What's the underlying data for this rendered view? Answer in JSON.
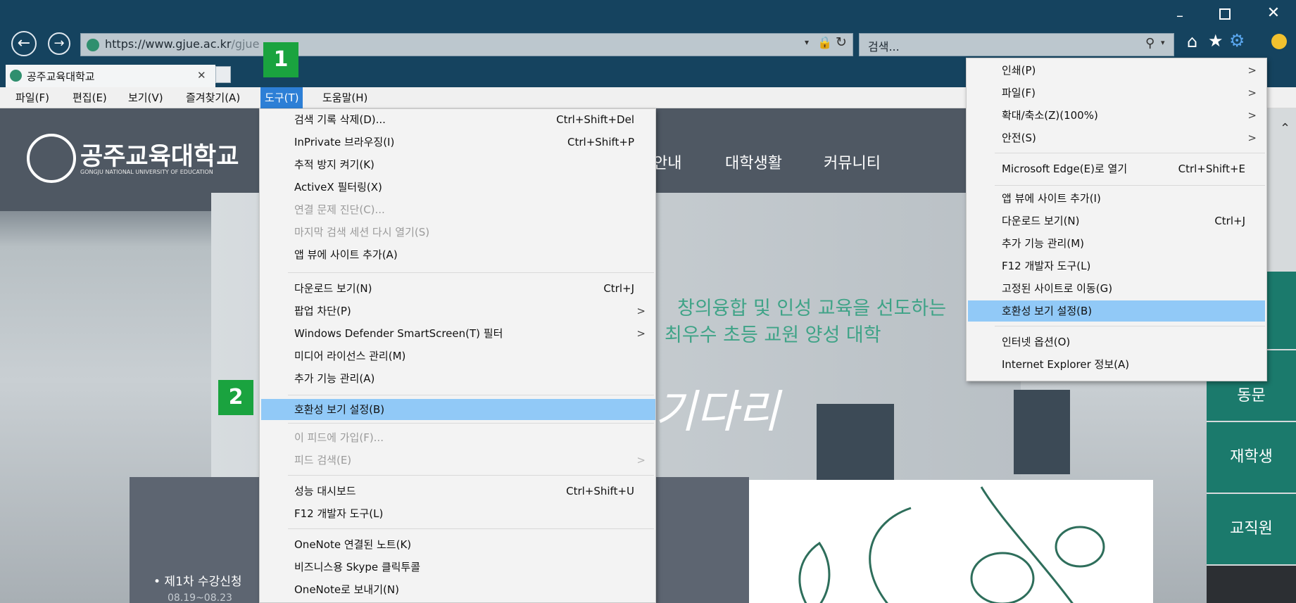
{
  "browser": {
    "url_host": "https://www.",
    "url_domain": "gjue.ac.kr",
    "url_path": "/gjue",
    "search_placeholder": "검색...",
    "tab_title": "공주교육대학교"
  },
  "menubar": {
    "items": [
      "파일(F)",
      "편집(E)",
      "보기(V)",
      "즐겨찾기(A)",
      "도구(T)",
      "도움말(H)"
    ]
  },
  "tools_menu": {
    "items": [
      {
        "label": "검색 기록 삭제(D)...",
        "shortcut": "Ctrl+Shift+Del"
      },
      {
        "label": "InPrivate 브라우징(I)",
        "shortcut": "Ctrl+Shift+P"
      },
      {
        "label": "추적 방지 켜기(K)"
      },
      {
        "label": "ActiveX 필터링(X)"
      },
      {
        "label": "연결 문제 진단(C)..."
      },
      {
        "label": "마지막 검색 세션 다시 열기(S)"
      },
      {
        "label": "앱 뷰에 사이트 추가(A)"
      },
      {
        "label": "다운로드 보기(N)",
        "shortcut": "Ctrl+J"
      },
      {
        "label": "팝업 차단(P)",
        "arrow": ">"
      },
      {
        "label": "Windows Defender SmartScreen(T) 필터",
        "arrow": ">"
      },
      {
        "label": "미디어 라이선스 관리(M)"
      },
      {
        "label": "추가 기능 관리(A)"
      },
      {
        "label": "호환성 보기 설정(B)"
      },
      {
        "label": "이 피드에 가입(F)..."
      },
      {
        "label": "피드 검색(E)",
        "arrow": ">"
      },
      {
        "label": "성능 대시보드",
        "shortcut": "Ctrl+Shift+U"
      },
      {
        "label": "F12 개발자 도구(L)"
      },
      {
        "label": "OneNote 연결된 노트(K)"
      },
      {
        "label": "비즈니스용 Skype 클릭투콜"
      },
      {
        "label": "OneNote로 보내기(N)"
      }
    ]
  },
  "gear_menu": {
    "items": [
      {
        "label": "인쇄(P)",
        "arrow": ">"
      },
      {
        "label": "파일(F)",
        "arrow": ">"
      },
      {
        "label": "확대/축소(Z)(100%)",
        "arrow": ">"
      },
      {
        "label": "안전(S)",
        "arrow": ">"
      },
      {
        "label": "Microsoft Edge(E)로 열기",
        "shortcut": "Ctrl+Shift+E"
      },
      {
        "label": "앱 뷰에 사이트 추가(I)"
      },
      {
        "label": "다운로드 보기(N)",
        "shortcut": "Ctrl+J"
      },
      {
        "label": "추가 기능 관리(M)"
      },
      {
        "label": "F12 개발자 도구(L)"
      },
      {
        "label": "고정된 사이트로 이동(G)"
      },
      {
        "label": "호환성 보기 설정(B)"
      },
      {
        "label": "인터넷 옵션(O)"
      },
      {
        "label": "Internet Explorer 정보(A)"
      }
    ]
  },
  "page": {
    "logo_text": "공주교육대학교",
    "logo_subtext": "GONGJU NATIONAL UNIVERSITY OF EDUCATION",
    "nav_partial": "안내",
    "nav_items": [
      "대학생활",
      "커뮤니티"
    ],
    "slogan_line1": "창의융합 및 인성 교육을 선도하는",
    "slogan_line2": "최우수 초등 교원 양성 대학",
    "script_text": "기다리",
    "notice": "• 제1차 수강신청",
    "notice_date": "08.19~08.23",
    "sidebar": [
      "동문",
      "재학생",
      "교직원"
    ]
  },
  "annotations": {
    "badge1": "1",
    "badge2": "2"
  },
  "colors": {
    "titlebar": "#15435f",
    "highlight": "#91c9f7",
    "badge": "#1aa33f",
    "teal": "#1b7a6c"
  }
}
